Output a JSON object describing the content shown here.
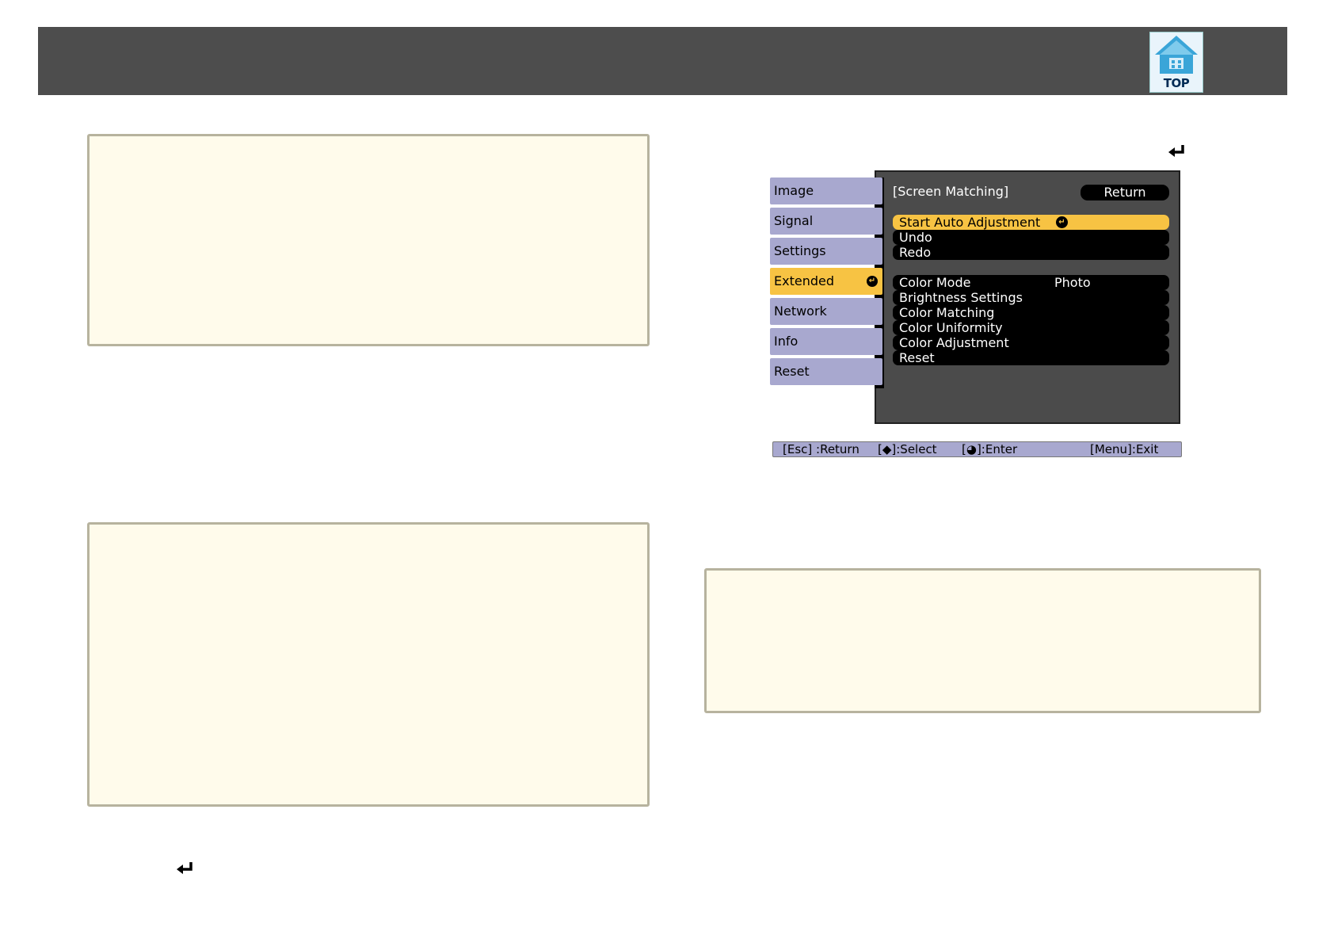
{
  "header": {
    "top_button_label": "TOP"
  },
  "icons": {
    "enter": "enter-arrow-icon",
    "top": "projector-top-icon"
  },
  "osd_menu": {
    "tabs": [
      {
        "label": "Image",
        "active": false
      },
      {
        "label": "Signal",
        "active": false
      },
      {
        "label": "Settings",
        "active": false
      },
      {
        "label": "Extended",
        "active": true
      },
      {
        "label": "Network",
        "active": false
      },
      {
        "label": "Info",
        "active": false
      },
      {
        "label": "Reset",
        "active": false
      }
    ],
    "panel_title": "[Screen Matching]",
    "return_label": "Return",
    "group1": [
      {
        "label": "Start Auto Adjustment",
        "selected": true
      },
      {
        "label": "Undo",
        "selected": false
      },
      {
        "label": "Redo",
        "selected": false
      }
    ],
    "group2": [
      {
        "label": "Color Mode",
        "value": "Photo"
      },
      {
        "label": "Brightness Settings",
        "value": ""
      },
      {
        "label": "Color Matching",
        "value": ""
      },
      {
        "label": "Color Uniformity",
        "value": ""
      },
      {
        "label": "Color Adjustment",
        "value": ""
      },
      {
        "label": "Reset",
        "value": ""
      }
    ],
    "help_bar": {
      "esc": "[Esc] :Return",
      "select": "[◆]:Select",
      "enter": "[◕]:Enter",
      "menu": "[Menu]:Exit"
    }
  },
  "colors": {
    "header": "#4d4d4d",
    "note_background": "#fffbeb",
    "note_border": "#b7b39e",
    "tab_inactive": "#a8a8cf",
    "highlight": "#f7c343",
    "panel": "#4b4b4b"
  }
}
